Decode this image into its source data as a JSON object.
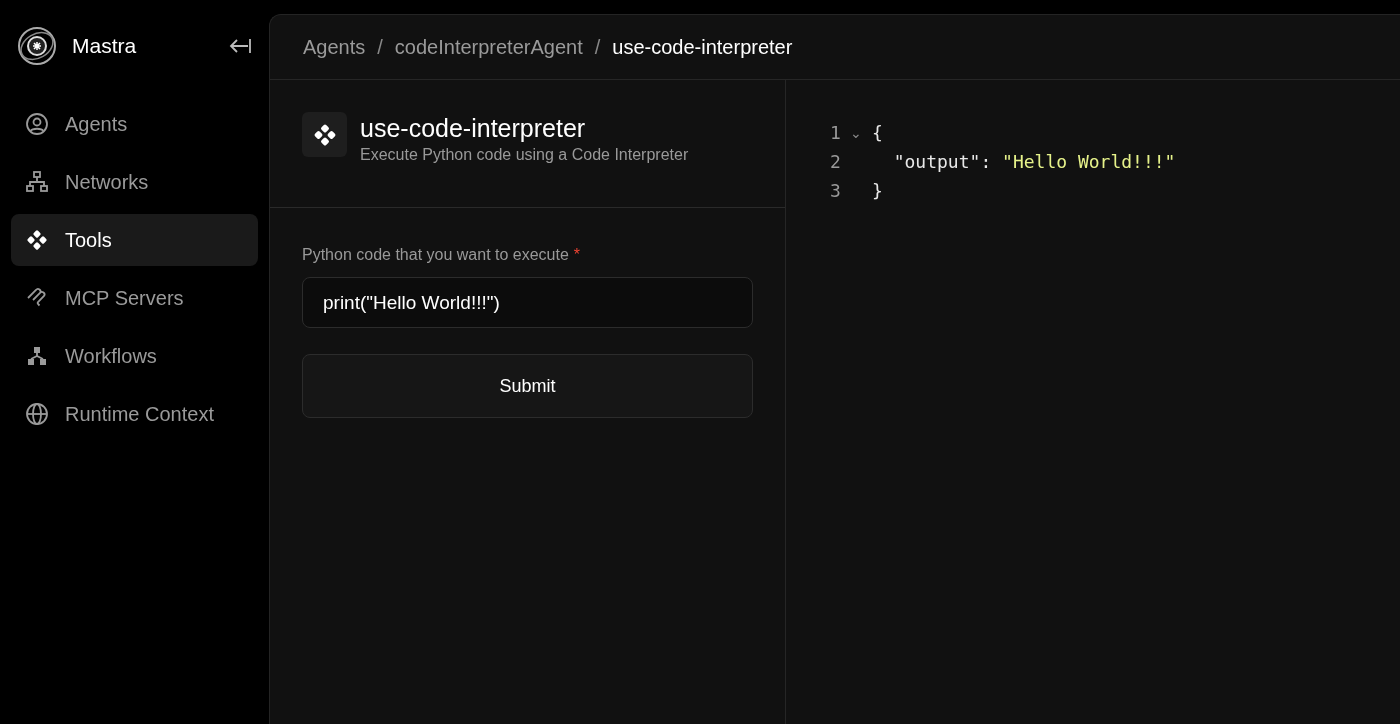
{
  "sidebar": {
    "brand": "Mastra",
    "items": [
      {
        "label": "Agents",
        "kind": "agent",
        "selected": false
      },
      {
        "label": "Networks",
        "kind": "network",
        "selected": false
      },
      {
        "label": "Tools",
        "kind": "tools",
        "selected": true
      },
      {
        "label": "MCP Servers",
        "kind": "mcp",
        "selected": false
      },
      {
        "label": "Workflows",
        "kind": "workflow",
        "selected": false
      },
      {
        "label": "Runtime Context",
        "kind": "globe",
        "selected": false
      }
    ]
  },
  "breadcrumb": [
    "Agents",
    "codeInterpreterAgent",
    "use-code-interpreter"
  ],
  "breadcrumb_separator": "/",
  "tool": {
    "name": "use-code-interpreter",
    "description": "Execute Python code using a Code Interpreter"
  },
  "form": {
    "field_label": "Python code that you want to execute",
    "required_mark": "*",
    "value": "print(\"Hello World!!!\")",
    "submit": "Submit"
  },
  "output": {
    "lines": [
      {
        "number": "1",
        "fold_marker": "⌄",
        "tokens": [
          {
            "kind": "punct",
            "text": "{"
          }
        ]
      },
      {
        "number": "2",
        "tokens": [
          {
            "kind": "key",
            "text": "  \"output\""
          },
          {
            "kind": "punct",
            "text": ": "
          },
          {
            "kind": "string",
            "text": "\"Hello World!!!\""
          }
        ]
      },
      {
        "number": "3",
        "tokens": [
          {
            "kind": "punct",
            "text": "}"
          }
        ]
      }
    ]
  }
}
